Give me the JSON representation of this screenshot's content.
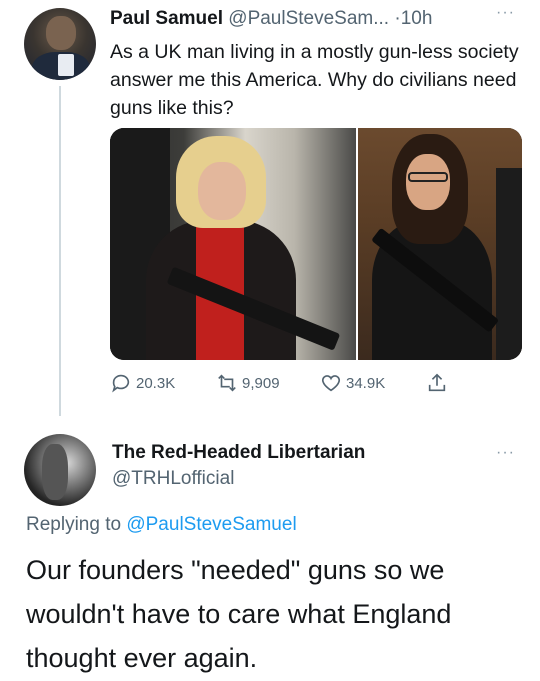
{
  "tweet": {
    "author_name": "Paul Samuel",
    "author_handle": "@PaulSteveSam...",
    "time": "·10h",
    "more": "···",
    "text": "As a UK man living in a mostly gun-less society answer me this America. Why do civilians need guns like this?",
    "replies": "20.3K",
    "retweets": "9,909",
    "likes": "34.9K"
  },
  "reply": {
    "author_name": "The Red-Headed Libertarian",
    "author_handle": "@TRHLofficial",
    "more": "···",
    "replying_to_prefix": "Replying to ",
    "replying_to_handle": "@PaulSteveSamuel",
    "text": "Our founders \"needed\" guns so we wouldn't have to care what England thought ever again."
  },
  "colors": {
    "link": "#1d9bf0",
    "secondary_text": "#536471",
    "primary_text": "#14171a"
  }
}
